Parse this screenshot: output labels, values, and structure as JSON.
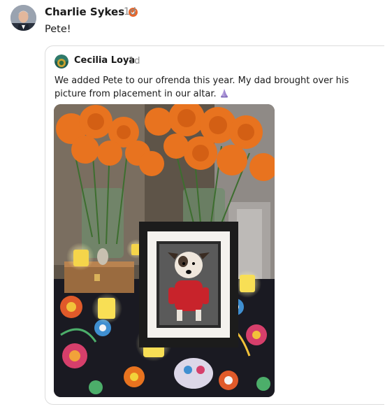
{
  "post": {
    "author": "Charlie Sykes",
    "time": "1d",
    "text": "Pete!"
  },
  "quoted_post": {
    "author": "Cecilia Loya",
    "time": "1d",
    "text": "We added Pete to our ofrenda this year. My dad brought over his picture from placement in our altar."
  },
  "icons": {
    "verified": "verified-badge-icon",
    "pray": "praying-hands-emoji"
  },
  "colors": {
    "verified": "#e8662a",
    "marigold": "#e8731f",
    "time_gray": "#8a8a8a"
  }
}
